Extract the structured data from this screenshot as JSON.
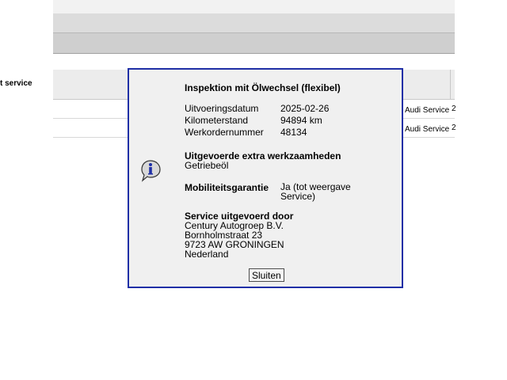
{
  "table": {
    "column_label": "t service",
    "rows": [
      {
        "service": "Audi Service",
        "extra": "2"
      },
      {
        "service": "Audi Service",
        "extra": "2"
      }
    ]
  },
  "dialog": {
    "title": "Inspektion mit Ölwechsel (flexibel)",
    "fields": [
      {
        "label": "Uitvoeringsdatum",
        "value": "2025-02-26"
      },
      {
        "label": "Kilometerstand",
        "value": "94894 km"
      },
      {
        "label": "Werkordernummer",
        "value": "48134"
      }
    ],
    "extra_work": {
      "heading": "Uitgevoerde extra werkzaamheden",
      "text": "Getriebeöl"
    },
    "mobility": {
      "heading": "Mobiliteitsgarantie",
      "value_line1": "Ja (tot weergave",
      "value_line2": "Service)"
    },
    "performed_by": {
      "heading": "Service uitgevoerd door",
      "line1": "Century Autogroep B.V.",
      "line2": "Bornholmstraat 23",
      "line3": "9723 AW GRONINGEN",
      "line4": "Nederland"
    },
    "close_label": "Sluiten",
    "icon": "info-icon"
  }
}
